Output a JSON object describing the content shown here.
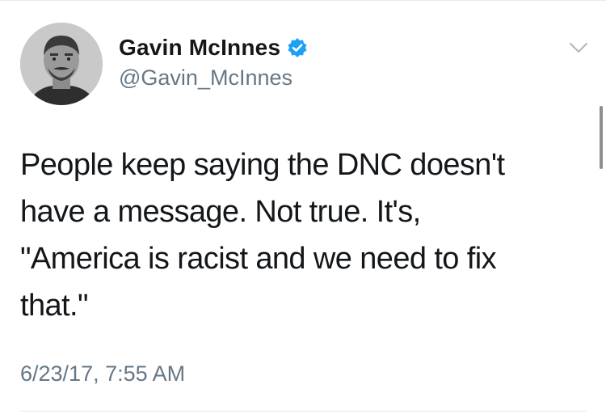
{
  "tweet": {
    "author": {
      "display_name": "Gavin McInnes",
      "handle": "@Gavin_McInnes",
      "verified": true
    },
    "text_lines": [
      "People keep saying the DNC doesn't",
      "have a message. Not true. It's,",
      "\"America is racist and we need to fix",
      "that.\""
    ],
    "timestamp": "6/23/17, 7:55 AM"
  },
  "icons": {
    "verified": "verified-badge-icon",
    "menu": "chevron-down-icon"
  },
  "colors": {
    "verified_badge": "#1da1f2",
    "secondary_text": "#657786",
    "primary_text": "#14171a"
  }
}
